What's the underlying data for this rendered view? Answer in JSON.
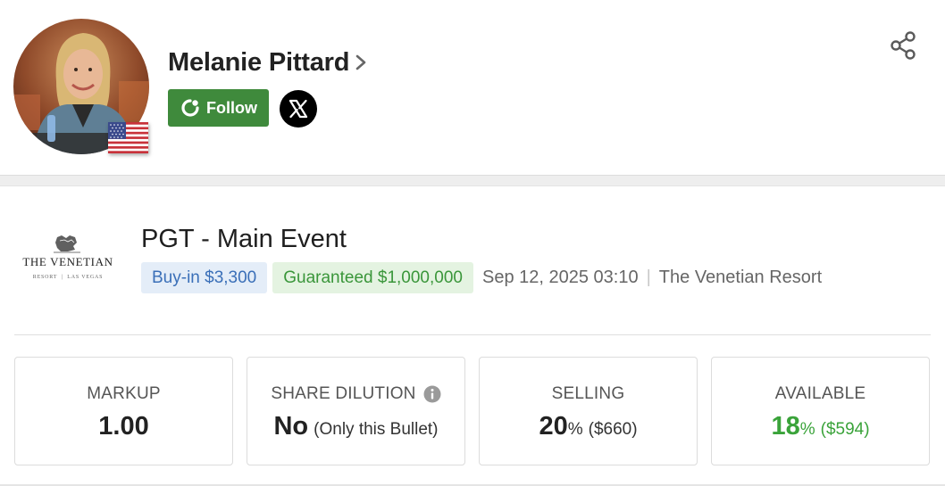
{
  "profile": {
    "name": "Melanie Pittard",
    "follow_label": "Follow",
    "country": "United States"
  },
  "event": {
    "venue_logo_name": "THE VENETIAN",
    "venue_logo_sub": "RESORT  |  LAS VEGAS",
    "title": "PGT - Main Event",
    "buyin": "Buy-in $3,300",
    "guaranteed": "Guaranteed $1,000,000",
    "datetime": "Sep 12, 2025 03:10",
    "separator": "|",
    "venue": "The Venetian Resort"
  },
  "stats": {
    "markup": {
      "label": "MARKUP",
      "value": "1.00"
    },
    "share_dilution": {
      "label": "SHARE DILUTION",
      "value": "No",
      "detail": "(Only this Bullet)"
    },
    "selling": {
      "label": "SELLING",
      "value": "20",
      "unit": "%",
      "detail": "($660)"
    },
    "available": {
      "label": "AVAILABLE",
      "value": "18",
      "unit": "%",
      "detail": "($594)"
    }
  },
  "colors": {
    "follow_bg": "#3f8a3c",
    "buyin_bg": "#e4edf8",
    "buyin_text": "#3a6fb8",
    "guaranteed_bg": "#e4f3e1",
    "guaranteed_text": "#3a963a",
    "available_green": "#3aa33a"
  }
}
